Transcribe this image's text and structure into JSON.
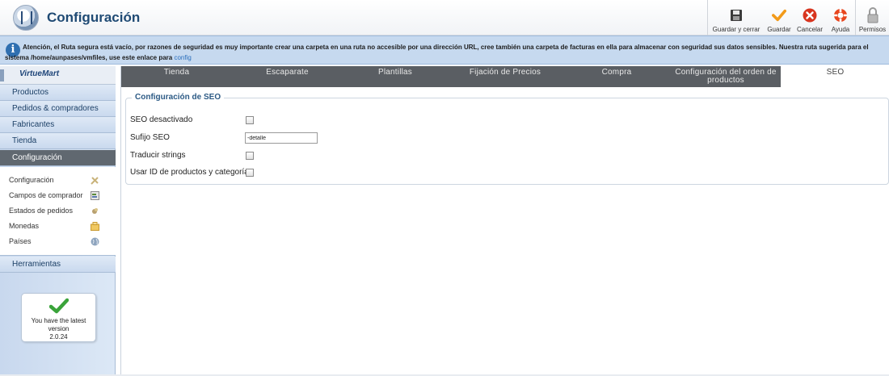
{
  "header": {
    "title": "Configuración",
    "toolbar": [
      {
        "label": "Guardar y cerrar",
        "icon": "save-disk-icon"
      },
      {
        "label": "Guardar",
        "icon": "checkmark-icon"
      },
      {
        "label": "Cancelar",
        "icon": "cancel-x-icon"
      },
      {
        "label": "Ayuda",
        "icon": "lifebuoy-help-icon"
      },
      {
        "label": "Permisos",
        "icon": "padlock-icon"
      }
    ]
  },
  "notice": {
    "icon": "info-icon",
    "text": "Atención, el Ruta segura está vacío, por razones de seguridad es muy importante crear una carpeta en una ruta no accesible por una dirección URL, cree también una carpeta de facturas en ella para almacenar con seguridad sus datos sensibles. Nuestra ruta sugerida para el sistema /home/aunpases/vmfiles, use este enlace para",
    "link": "config"
  },
  "sidebar": {
    "brand": "VirtueMart",
    "nav": [
      "Productos",
      "Pedidos & compradores",
      "Fabricantes",
      "Tienda",
      "Configuración"
    ],
    "active": "Configuración",
    "submenu": [
      {
        "label": "Configuración",
        "icon": "tools-icon"
      },
      {
        "label": "Campos de comprador",
        "icon": "form-fields-icon"
      },
      {
        "label": "Estados de pedidos",
        "icon": "order-status-icon"
      },
      {
        "label": "Monedas",
        "icon": "coins-icon"
      },
      {
        "label": "Países",
        "icon": "globe-icon"
      }
    ],
    "tools": "Herramientas",
    "version": {
      "line1": "You have the latest",
      "line2": "version",
      "number": "2.0.24"
    }
  },
  "tabs": [
    "Tienda",
    "Escaparate",
    "Plantillas",
    "Fijación de Precios",
    "Compra",
    "Configuración del orden de productos",
    "SEO"
  ],
  "active_tab": "SEO",
  "seo": {
    "legend": "Configuración de SEO",
    "fields": [
      {
        "label": "SEO desactivado",
        "type": "checkbox",
        "checked": false
      },
      {
        "label": "Sufijo SEO",
        "type": "text",
        "value": "-detalle"
      },
      {
        "label": "Traducir strings",
        "type": "checkbox",
        "checked": false
      },
      {
        "label": "Usar ID de productos y categorías",
        "type": "checkbox",
        "checked": false
      }
    ]
  },
  "colors": {
    "accent": "#1f4a74",
    "notice_bg": "#c6d9ef",
    "tab_bar": "#5a5e63",
    "active_nav": "#606870"
  }
}
